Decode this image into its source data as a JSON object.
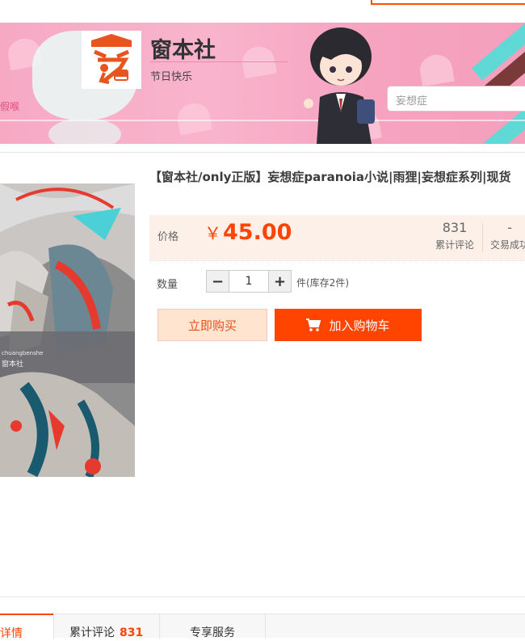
{
  "shop": {
    "name": "窗本社",
    "subtitle": "节日快乐",
    "left_caption": "假喉",
    "search_placeholder": "妄想症"
  },
  "image_watermark": {
    "line1": "chuangbenshe",
    "line2": "窗本社"
  },
  "product": {
    "title": "【窗本社/only正版】妄想症paranoia小说|雨狸|妄想症系列|现货",
    "price_label": "价格",
    "currency": "￥",
    "price": "45.00",
    "reviews_count": "831",
    "reviews_label": "累计评论",
    "deals_count": "-",
    "deals_label": "交易成功"
  },
  "quantity": {
    "label": "数量",
    "minus": "−",
    "value": "1",
    "plus": "+",
    "stock_text": "件(库存2件)"
  },
  "actions": {
    "buy_now": "立即购买",
    "add_to_cart": "加入购物车"
  },
  "tabs": [
    {
      "label": "详情"
    },
    {
      "label": "累计评论",
      "count": "831"
    },
    {
      "label": "专享服务"
    }
  ],
  "colors": {
    "accent": "#ff4400",
    "banner_pink": "#f7a9c4",
    "price_bg": "#fdf0e8"
  }
}
